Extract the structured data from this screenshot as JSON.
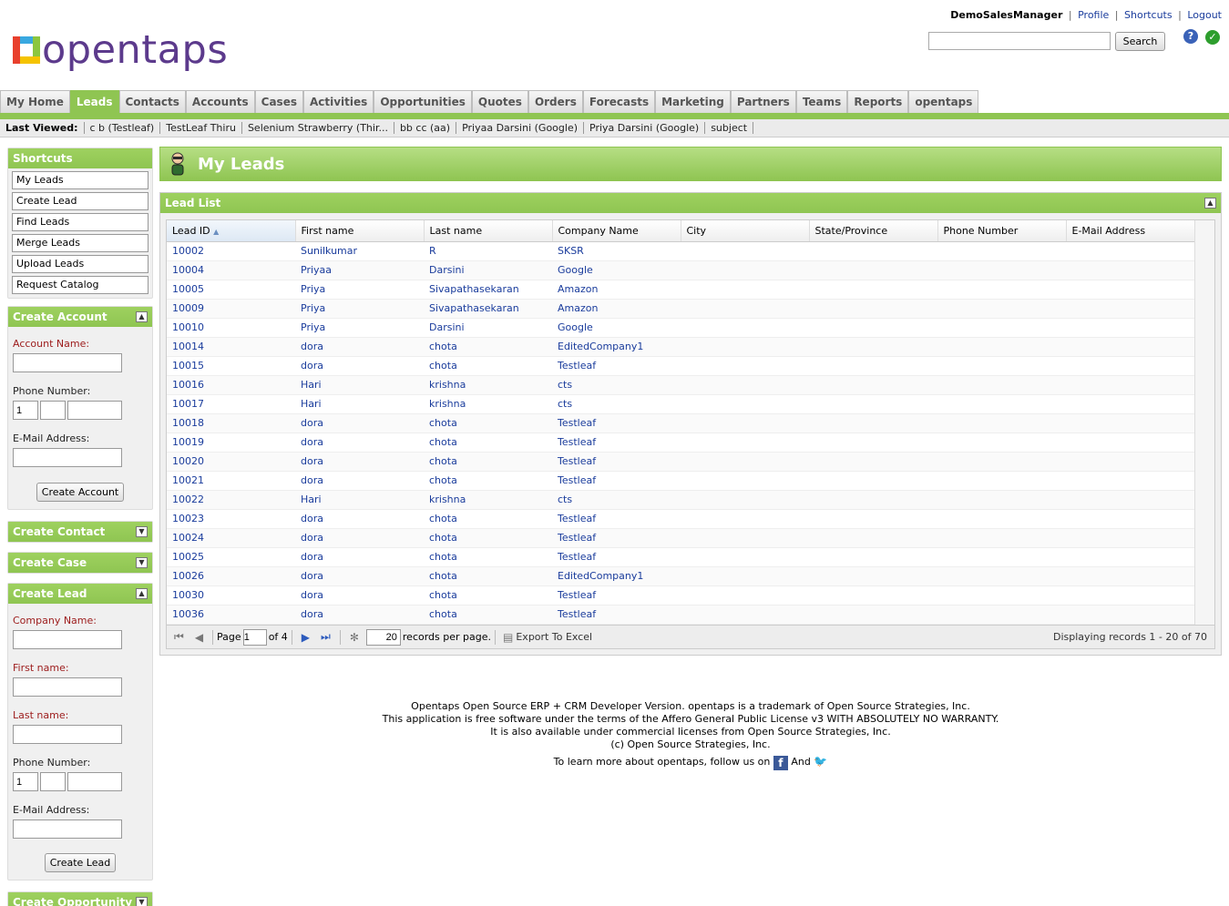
{
  "header": {
    "user": "DemoSalesManager",
    "links": [
      "Profile",
      "Shortcuts",
      "Logout"
    ],
    "search_button": "Search",
    "logo_text": "opentaps"
  },
  "tabs": [
    "My Home",
    "Leads",
    "Contacts",
    "Accounts",
    "Cases",
    "Activities",
    "Opportunities",
    "Quotes",
    "Orders",
    "Forecasts",
    "Marketing",
    "Partners",
    "Teams",
    "Reports",
    "opentaps"
  ],
  "active_tab": "Leads",
  "last_viewed": {
    "label": "Last Viewed:",
    "items": [
      "c b (Testleaf)",
      "TestLeaf Thiru",
      "Selenium Strawberry (Thir...",
      "bb cc (aa)",
      "Priyaa Darsini (Google)",
      "Priya Darsini (Google)",
      "subject"
    ]
  },
  "sidebar": {
    "shortcuts": {
      "title": "Shortcuts",
      "items": [
        "My Leads",
        "Create Lead",
        "Find Leads",
        "Merge Leads",
        "Upload Leads",
        "Request Catalog"
      ]
    },
    "create_account": {
      "title": "Create Account",
      "account_name": "Account Name:",
      "phone": "Phone Number:",
      "phone_country": "1",
      "email": "E-Mail Address:",
      "button": "Create Account"
    },
    "create_contact": {
      "title": "Create Contact"
    },
    "create_case": {
      "title": "Create Case"
    },
    "create_lead": {
      "title": "Create Lead",
      "company": "Company Name:",
      "first": "First name:",
      "last": "Last name:",
      "phone": "Phone Number:",
      "phone_country": "1",
      "email": "E-Mail Address:",
      "button": "Create Lead"
    },
    "create_opportunity": {
      "title": "Create Opportunity"
    }
  },
  "main": {
    "title": "My Leads",
    "panel_title": "Lead List",
    "columns": [
      "Lead ID",
      "First name",
      "Last name",
      "Company Name",
      "City",
      "State/Province",
      "Phone Number",
      "E-Mail Address"
    ],
    "rows": [
      [
        "10002",
        "Sunilkumar",
        "R",
        "SKSR"
      ],
      [
        "10004",
        "Priyaa",
        "Darsini",
        "Google"
      ],
      [
        "10005",
        "Priya",
        "Sivapathasekaran",
        "Amazon"
      ],
      [
        "10009",
        "Priya",
        "Sivapathasekaran",
        "Amazon"
      ],
      [
        "10010",
        "Priya",
        "Darsini",
        "Google"
      ],
      [
        "10014",
        "dora",
        "chota",
        "EditedCompany1"
      ],
      [
        "10015",
        "dora",
        "chota",
        "Testleaf"
      ],
      [
        "10016",
        "Hari",
        "krishna",
        "cts"
      ],
      [
        "10017",
        "Hari",
        "krishna",
        "cts"
      ],
      [
        "10018",
        "dora",
        "chota",
        "Testleaf"
      ],
      [
        "10019",
        "dora",
        "chota",
        "Testleaf"
      ],
      [
        "10020",
        "dora",
        "chota",
        "Testleaf"
      ],
      [
        "10021",
        "dora",
        "chota",
        "Testleaf"
      ],
      [
        "10022",
        "Hari",
        "krishna",
        "cts"
      ],
      [
        "10023",
        "dora",
        "chota",
        "Testleaf"
      ],
      [
        "10024",
        "dora",
        "chota",
        "Testleaf"
      ],
      [
        "10025",
        "dora",
        "chota",
        "Testleaf"
      ],
      [
        "10026",
        "dora",
        "chota",
        "EditedCompany1"
      ],
      [
        "10030",
        "dora",
        "chota",
        "Testleaf"
      ],
      [
        "10036",
        "dora",
        "chota",
        "Testleaf"
      ]
    ],
    "pager": {
      "page_label": "Page",
      "page_value": "1",
      "of_label": "of 4",
      "per_page_value": "20",
      "per_page_label": "records per page.",
      "export": "Export To Excel",
      "displaying": "Displaying records 1 - 20 of 70"
    }
  },
  "footer": {
    "line1": "Opentaps Open Source ERP + CRM Developer Version. opentaps is a trademark of Open Source Strategies, Inc.",
    "line2": "This application is free software under the terms of the Affero General Public License v3 WITH ABSOLUTELY NO WARRANTY.",
    "line3": "It is also available under commercial licenses from Open Source Strategies, Inc.",
    "line4": "(c) Open Source Strategies, Inc.",
    "line5": "To learn more about opentaps, follow us on",
    "and": "And"
  }
}
